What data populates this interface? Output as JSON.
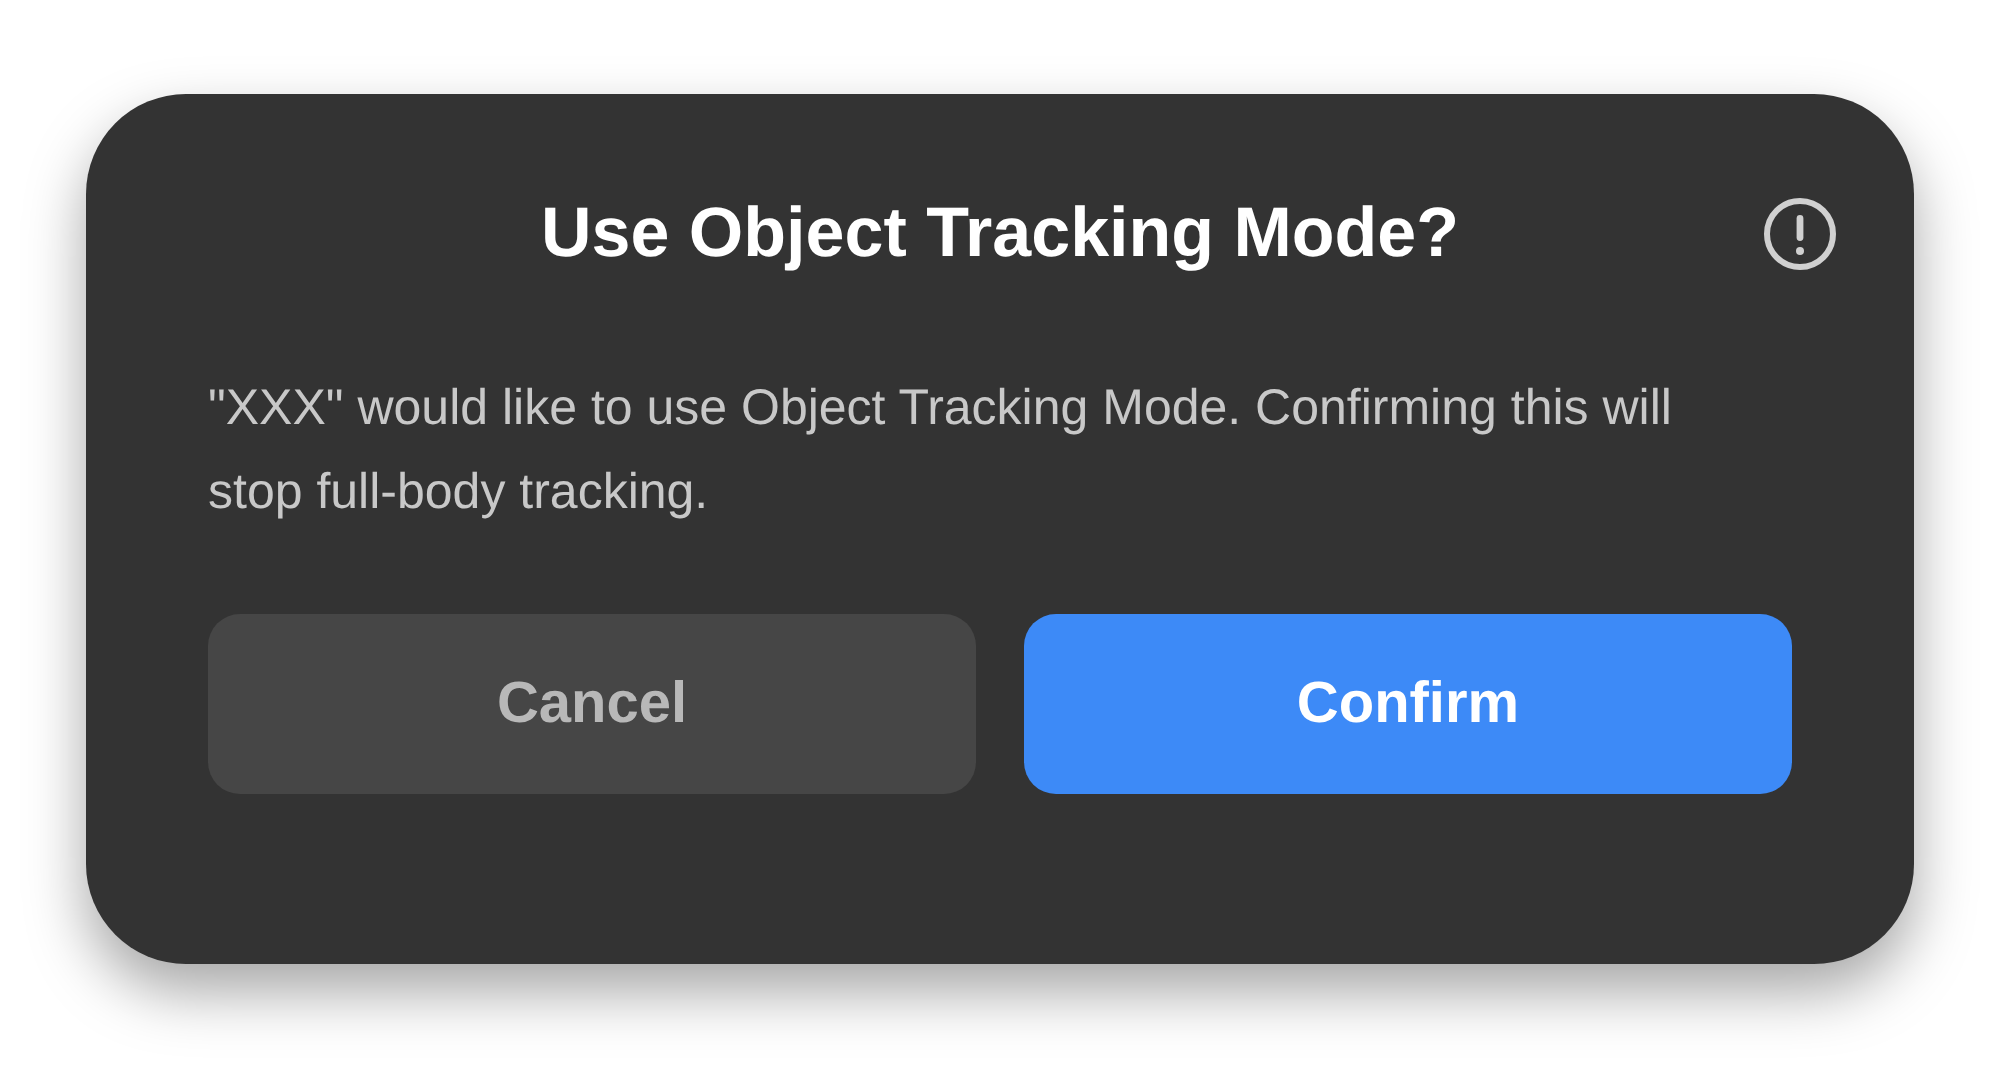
{
  "dialog": {
    "title": "Use Object Tracking Mode?",
    "message": "\"XXX\" would like to use Object Tracking Mode. Confirming this will stop full-body tracking.",
    "buttons": [
      {
        "label": "Cancel",
        "kind": "secondary"
      },
      {
        "label": "Confirm",
        "kind": "primary"
      }
    ]
  }
}
